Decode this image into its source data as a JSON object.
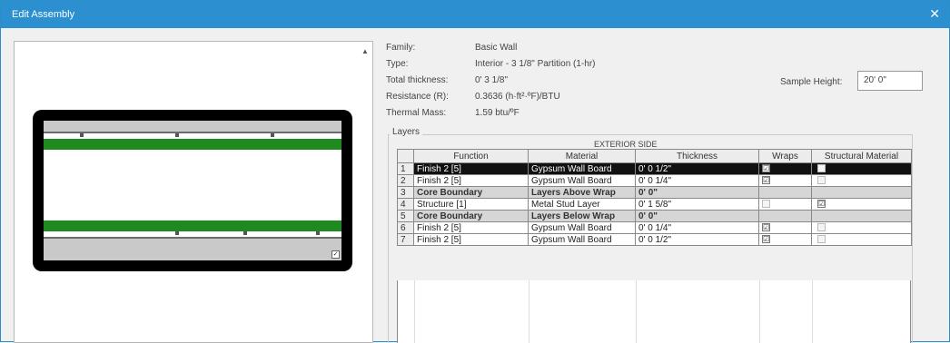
{
  "window": {
    "title": "Edit Assembly",
    "close_symbol": "✕"
  },
  "properties": [
    {
      "label": "Family:",
      "value": "Basic Wall"
    },
    {
      "label": "Type:",
      "value": "Interior - 3 1/8\" Partition (1-hr)"
    },
    {
      "label": "Total thickness:",
      "value": "0' 3 1/8\""
    },
    {
      "label": "Resistance (R):",
      "value": "0.3636 (h·ft²·ºF)/BTU"
    },
    {
      "label": "Thermal Mass:",
      "value": "1.59 btu/ºF"
    }
  ],
  "sample_height": {
    "label": "Sample Height:",
    "value": "20' 0\""
  },
  "layers": {
    "legend": "Layers",
    "side_label": "EXTERIOR SIDE",
    "columns": [
      "Function",
      "Material",
      "Thickness",
      "Wraps",
      "Structural Material"
    ],
    "rows": [
      {
        "num": "1",
        "function": "Finish 2 [5]",
        "material": "Gypsum Wall Board",
        "thickness": "0' 0 1/2\"",
        "wraps": true,
        "structural": false,
        "kind": "selected"
      },
      {
        "num": "2",
        "function": "Finish 2 [5]",
        "material": "Gypsum Wall Board",
        "thickness": "0' 0 1/4\"",
        "wraps": true,
        "structural": false,
        "kind": "normal"
      },
      {
        "num": "3",
        "function": "Core Boundary",
        "material": "Layers Above Wrap",
        "thickness": "0' 0\"",
        "wraps": null,
        "structural": null,
        "kind": "boundary"
      },
      {
        "num": "4",
        "function": "Structure [1]",
        "material": "Metal Stud Layer",
        "thickness": "0' 1 5/8\"",
        "wraps": false,
        "structural": true,
        "kind": "normal"
      },
      {
        "num": "5",
        "function": "Core Boundary",
        "material": "Layers Below Wrap",
        "thickness": "0' 0\"",
        "wraps": null,
        "structural": null,
        "kind": "boundary"
      },
      {
        "num": "6",
        "function": "Finish 2 [5]",
        "material": "Gypsum Wall Board",
        "thickness": "0' 0 1/4\"",
        "wraps": true,
        "structural": false,
        "kind": "normal"
      },
      {
        "num": "7",
        "function": "Finish 2 [5]",
        "material": "Gypsum Wall Board",
        "thickness": "0' 0 1/2\"",
        "wraps": true,
        "structural": false,
        "kind": "normal"
      }
    ]
  },
  "colors": {
    "titlebar": "#2b8fd0",
    "core_layer": "#1f8a1f",
    "finish_layer": "#c9c9c9",
    "selected_row": "#111111"
  },
  "icons": {
    "close": "close-icon",
    "scroll_up": "scroll-up-arrow-icon",
    "checkbox_checked": "☑"
  }
}
